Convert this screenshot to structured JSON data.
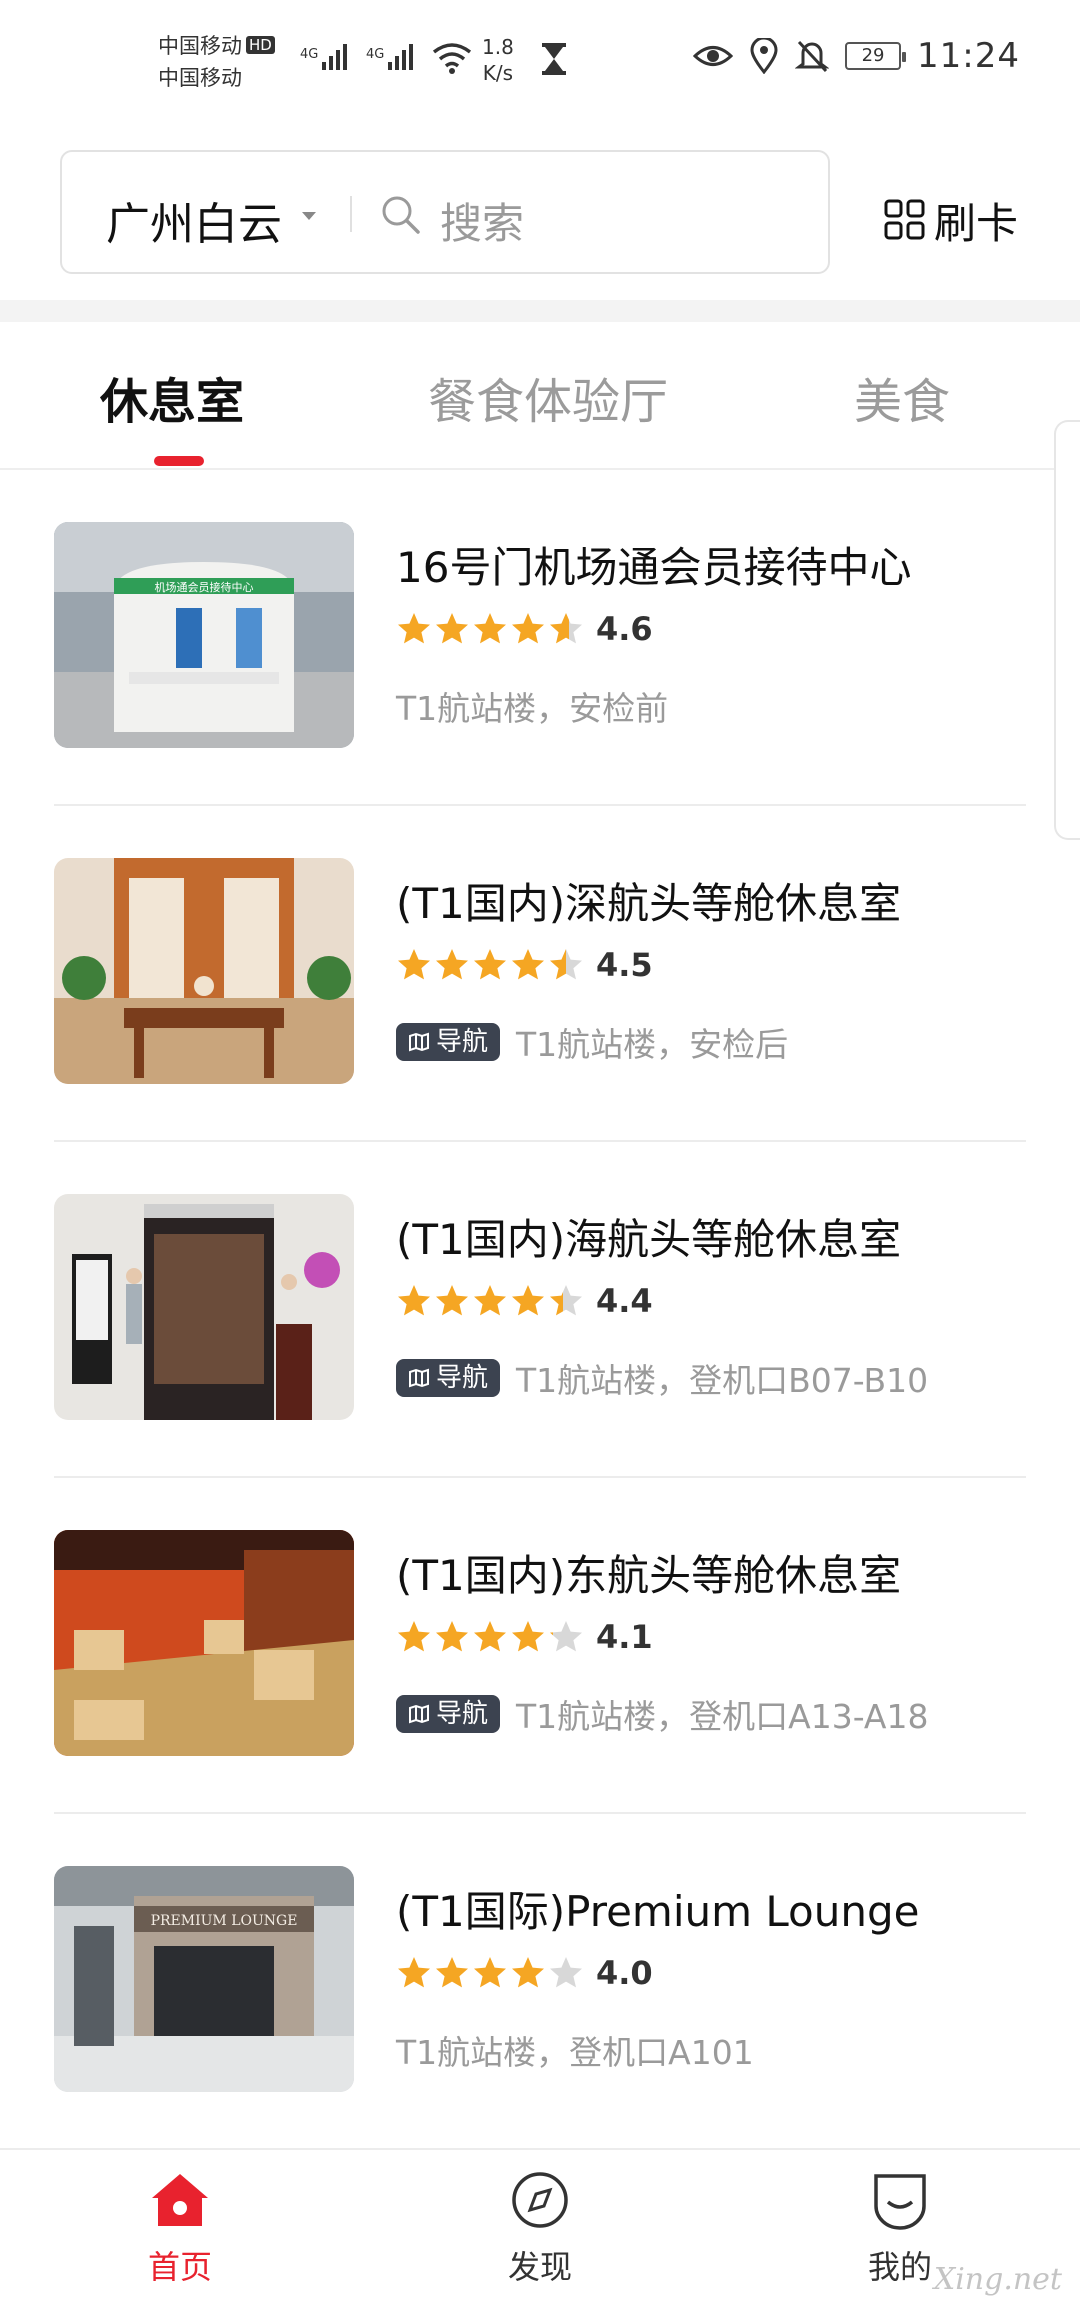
{
  "status_bar": {
    "carrier1": "中国移动",
    "carrier1_badge": "HD",
    "carrier2": "中国移动",
    "net_speed_value": "1.8",
    "net_speed_unit": "K/s",
    "battery": "29",
    "time": "11:24"
  },
  "header": {
    "city": "广州白云",
    "search_placeholder": "搜索",
    "card_label": "刷卡"
  },
  "tabs": [
    {
      "label": "休息室",
      "active": true
    },
    {
      "label": "餐食体验厅",
      "active": false
    },
    {
      "label": "美食",
      "active": false
    }
  ],
  "lounges": [
    {
      "title": "16号门机场通会员接待中心",
      "rating": "4.6",
      "stars": 4.6,
      "nav_label": "",
      "location": "T1航站楼，安检前",
      "thumb_text": "机场通会员接待中心"
    },
    {
      "title": "(T1国内)深航头等舱休息室",
      "rating": "4.5",
      "stars": 4.5,
      "nav_label": "导航",
      "location": "T1航站楼，安检后",
      "thumb_text": ""
    },
    {
      "title": "(T1国内)海航头等舱休息室",
      "rating": "4.4",
      "stars": 4.4,
      "nav_label": "导航",
      "location": "T1航站楼，登机口B07-B10",
      "thumb_text": ""
    },
    {
      "title": "(T1国内)东航头等舱休息室",
      "rating": "4.1",
      "stars": 4.1,
      "nav_label": "导航",
      "location": "T1航站楼，登机口A13-A18",
      "thumb_text": ""
    },
    {
      "title": "(T1国际)Premium Lounge",
      "rating": "4.0",
      "stars": 4.0,
      "nav_label": "",
      "location": "T1航站楼，登机口A101",
      "thumb_text": "PREMIUM LOUNGE"
    }
  ],
  "bottom_nav": [
    {
      "label": "首页",
      "icon": "home-icon",
      "active": true
    },
    {
      "label": "发现",
      "icon": "compass-icon",
      "active": false
    },
    {
      "label": "我的",
      "icon": "profile-icon",
      "active": false
    }
  ],
  "watermark": "Xing.net",
  "colors": {
    "accent": "#e8222e",
    "star": "#f5a623",
    "star_empty": "#d8d8d8",
    "badge": "#3c4350"
  }
}
